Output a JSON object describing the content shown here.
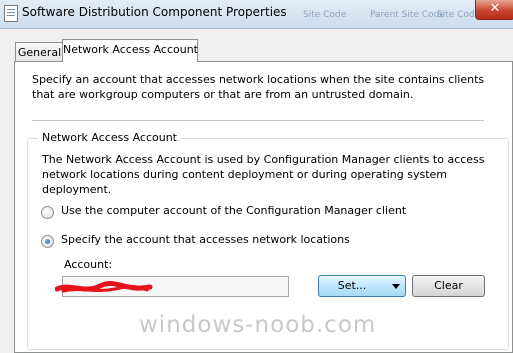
{
  "window": {
    "title": "Software Distribution Component Properties",
    "ghost_tabs": [
      "Site Code",
      "Parent Site Code",
      "Site Code"
    ],
    "close_label": "✕"
  },
  "tabs": [
    {
      "label": "General"
    },
    {
      "label": "Network Access Account"
    }
  ],
  "page": {
    "description": "Specify an account that accesses network locations when the site contains clients that are workgroup computers or that are from an untrusted domain.",
    "group": {
      "title": "Network Access Account",
      "description": "The Network Access Account is used by Configuration Manager clients to access network locations during content deployment or during operating system deployment.",
      "radio_computer_account": "Use the computer account of the Configuration Manager client",
      "radio_specify_account": "Specify the account that accesses network locations",
      "selected_option": "Specify the account that accesses network locations",
      "account_label": "Account:",
      "account_value": "",
      "set_label": "Set...",
      "clear_label": "Clear"
    }
  },
  "watermark": "windows-noob.com",
  "colors": {
    "redaction": "#e8121a",
    "focus_button": "#bee6fd",
    "title_bar": "#cbdcee"
  },
  "icons": {
    "window": "properties-document-icon",
    "dropdown": "chevron-down-icon",
    "close": "close-icon"
  }
}
